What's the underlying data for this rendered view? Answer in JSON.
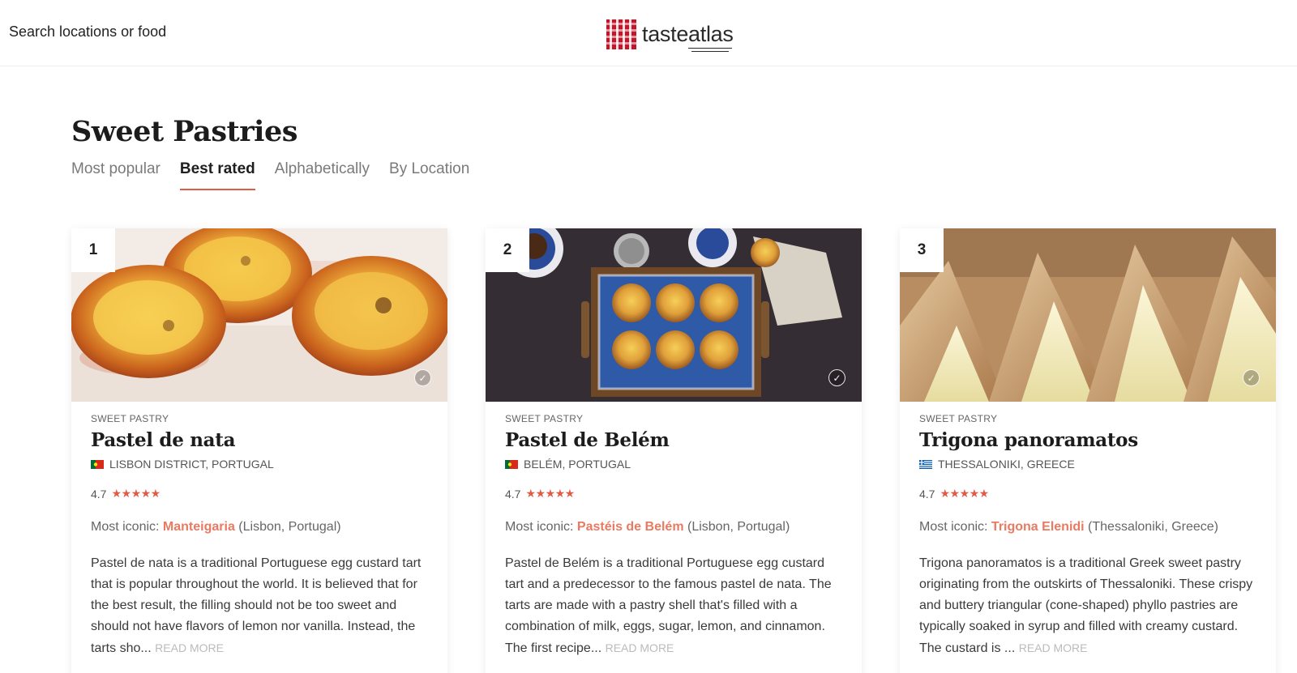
{
  "header": {
    "search_label": "Search locations or food",
    "logo_text_1": "taste",
    "logo_text_2": "atlas"
  },
  "page": {
    "title": "Sweet Pastries",
    "tabs": [
      {
        "label": "Most popular",
        "active": false
      },
      {
        "label": "Best rated",
        "active": true
      },
      {
        "label": "Alphabetically",
        "active": false
      },
      {
        "label": "By Location",
        "active": false
      }
    ]
  },
  "colors": {
    "accent": "#e25b45",
    "link": "#e87a62"
  },
  "cards": [
    {
      "rank": "1",
      "category": "SWEET PASTRY",
      "name": "Pastel de nata",
      "flag": "portugal-flag",
      "location": "LISBON DISTRICT, PORTUGAL",
      "rating": "4.7",
      "stars": "★★★★★",
      "iconic_prefix": "Most iconic: ",
      "iconic_place": "Manteigaria",
      "iconic_suffix": " (Lisbon, Portugal)",
      "description": "Pastel de nata is a traditional Portuguese egg custard tart that is popular throughout the world. It is believed that for the best result, the filling should not be too sweet and should not have flavors of lemon nor vanilla. Instead, the tarts sho...",
      "read_more": "READ MORE"
    },
    {
      "rank": "2",
      "category": "SWEET PASTRY",
      "name": "Pastel de Belém",
      "flag": "portugal-flag",
      "location": "BELÉM, PORTUGAL",
      "rating": "4.7",
      "stars": "★★★★★",
      "iconic_prefix": "Most iconic: ",
      "iconic_place": "Pastéis de Belém",
      "iconic_suffix": " (Lisbon, Portugal)",
      "description": "Pastel de Belém is a traditional Portuguese egg custard tart and a predecessor to the famous pastel de nata. The tarts are made with a pastry shell that's filled with a combination of milk, eggs, sugar, lemon, and cinnamon. The first recipe...",
      "read_more": "READ MORE"
    },
    {
      "rank": "3",
      "category": "SWEET PASTRY",
      "name": "Trigona panoramatos",
      "flag": "greece-flag",
      "location": "THESSALONIKI, GREECE",
      "rating": "4.7",
      "stars": "★★★★★",
      "iconic_prefix": "Most iconic: ",
      "iconic_place": "Trigona Elenidi",
      "iconic_suffix": " (Thessaloniki, Greece)",
      "description": "Trigona panoramatos is a traditional Greek sweet pastry originating from the outskirts of Thessaloniki. These crispy and buttery triangular (cone-shaped) phyllo pastries are typically soaked in syrup and filled with creamy custard. The custard is ...",
      "read_more": "READ MORE"
    }
  ]
}
